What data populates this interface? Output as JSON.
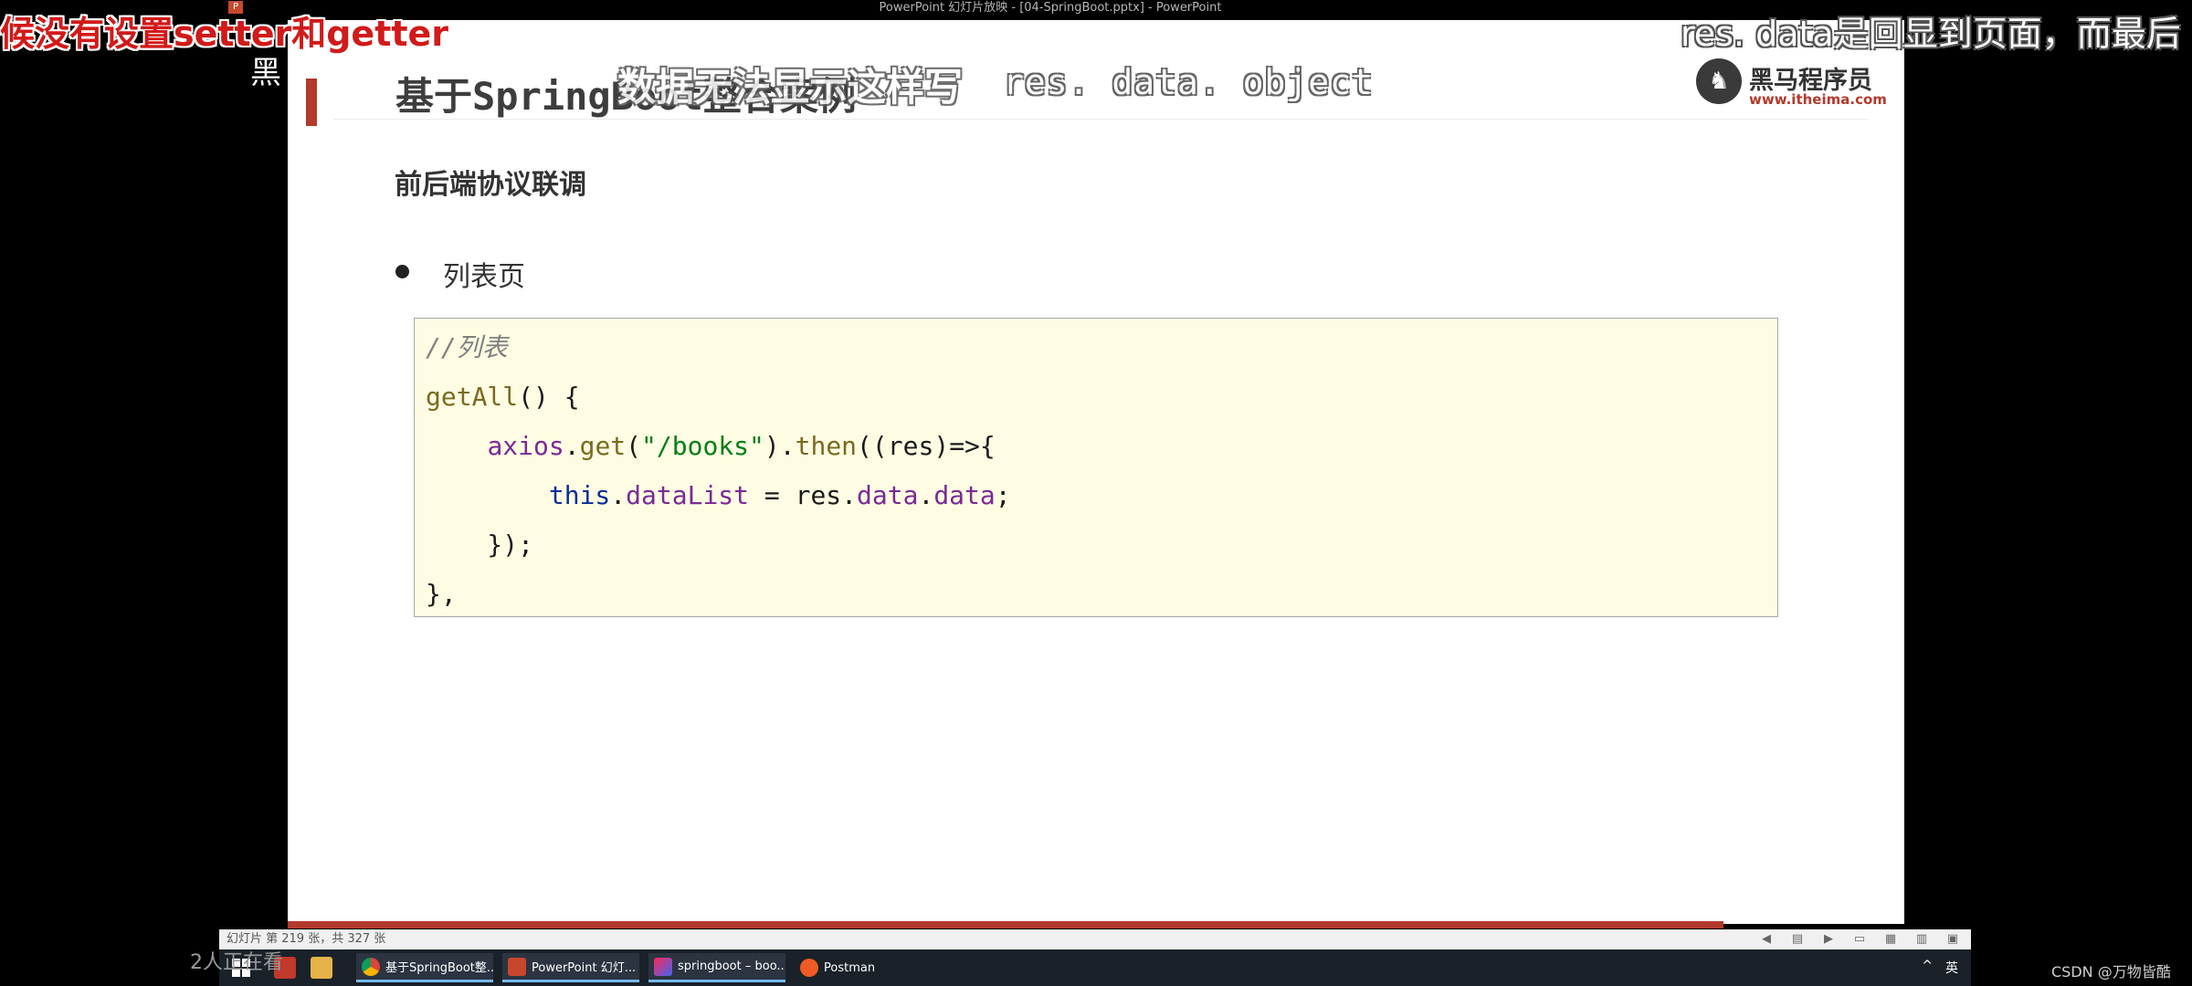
{
  "window": {
    "title": "PowerPoint 幻灯片放映 - [04-SpringBoot.pptx] - PowerPoint"
  },
  "slide": {
    "title": "基于SpringBoot整合案例",
    "logo_text": "黑马程序员",
    "logo_url": "www.itheima.com",
    "subtitle": "前后端协议联调",
    "bullet": "列表页",
    "code": {
      "line1": "//列表",
      "line2_fn": "getAll",
      "line2_rest": "() {",
      "line3_indent": "    ",
      "line3_obj": "axios",
      "line3_dot1": ".",
      "line3_get": "get",
      "line3_open": "(",
      "line3_str": "\"/books\"",
      "line3_close": ").",
      "line3_then": "then",
      "line3_rest": "((res)=>{",
      "line4_indent": "        ",
      "line4_this": "this",
      "line4_dot": ".",
      "line4_prop": "dataList",
      "line4_eq": " = res.",
      "line4_data1": "data",
      "line4_dot2": ".",
      "line4_data2": "data",
      "line4_end": ";",
      "line5": "    });",
      "line6": "},"
    }
  },
  "overlays": {
    "red_caption": "候没有设置setter和getter",
    "left_char": "黑",
    "mid_caption": "数据无法显示这样写",
    "res_caption": "res. data. object",
    "right_caption": "res. data是回显到页面，而最后"
  },
  "statusbar": {
    "slide_info": "幻灯片 第 219 张，共 327 张"
  },
  "taskbar": {
    "items": [
      {
        "label": "基于SpringBoot整..."
      },
      {
        "label": "PowerPoint 幻灯..."
      },
      {
        "label": "springboot – boo..."
      },
      {
        "label": "Postman"
      }
    ],
    "tray_lang": "英",
    "viewers": "2人正在看"
  },
  "watermark": "CSDN @万物皆酷",
  "colors": {
    "accent_red": "#b33a2c",
    "code_bg": "#fefde3",
    "taskbar_bg": "#1a2129"
  }
}
